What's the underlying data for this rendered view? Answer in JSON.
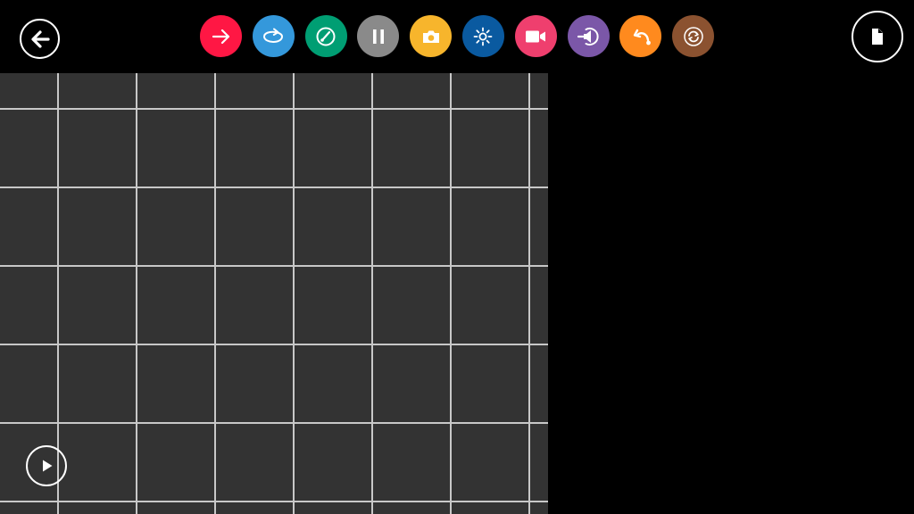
{
  "topbar": {
    "back_button": {
      "icon": "arrow-left-icon"
    },
    "document_button": {
      "icon": "document-icon"
    }
  },
  "tools": [
    {
      "name": "move-forward",
      "icon": "arrow-right-icon",
      "color": "#ff1744"
    },
    {
      "name": "rotate",
      "icon": "rotate-arrow-icon",
      "color": "#3498db"
    },
    {
      "name": "speed",
      "icon": "gauge-icon",
      "color": "#009e73"
    },
    {
      "name": "pause",
      "icon": "pause-icon",
      "color": "#8a8a8a"
    },
    {
      "name": "camera",
      "icon": "camera-icon",
      "color": "#f7b52c"
    },
    {
      "name": "light",
      "icon": "sun-icon",
      "color": "#0a5aa0"
    },
    {
      "name": "video",
      "icon": "video-camera-icon",
      "color": "#ef3f6e"
    },
    {
      "name": "sound",
      "icon": "speaker-icon",
      "color": "#7b57a8"
    },
    {
      "name": "flip",
      "icon": "curved-arrow-icon",
      "color": "#ff8a1e"
    },
    {
      "name": "loop",
      "icon": "loop-icon",
      "color": "#8b5230"
    }
  ],
  "canvas": {
    "background": "#333333",
    "grid_color": "#c8c8c8",
    "play_button": {
      "icon": "play-icon"
    }
  }
}
